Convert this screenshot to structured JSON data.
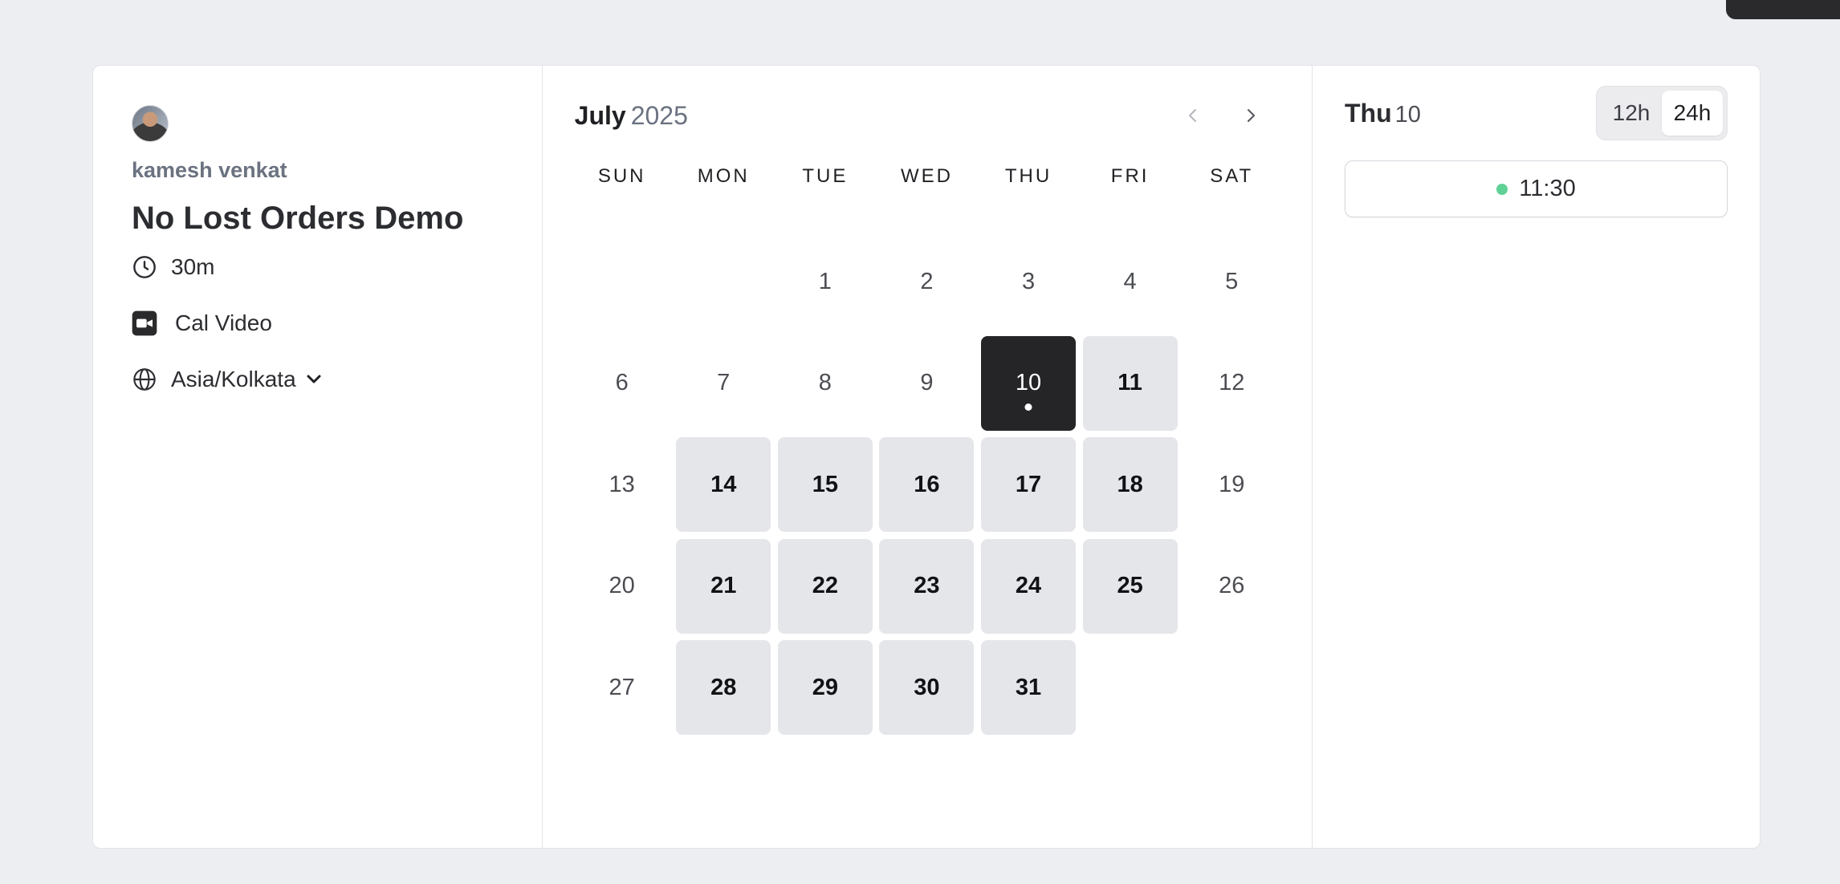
{
  "profile": {
    "host_name": "kamesh venkat",
    "event_title": "No Lost Orders Demo",
    "duration": "30m",
    "location": "Cal Video",
    "timezone": "Asia/Kolkata"
  },
  "calendar": {
    "month": "July",
    "year": "2025",
    "weekdays": [
      "SUN",
      "MON",
      "TUE",
      "WED",
      "THU",
      "FRI",
      "SAT"
    ],
    "days": [
      {
        "label": "",
        "state": "empty"
      },
      {
        "label": "",
        "state": "empty"
      },
      {
        "label": "1",
        "state": "unavailable"
      },
      {
        "label": "2",
        "state": "unavailable"
      },
      {
        "label": "3",
        "state": "unavailable"
      },
      {
        "label": "4",
        "state": "unavailable"
      },
      {
        "label": "5",
        "state": "unavailable"
      },
      {
        "label": "6",
        "state": "unavailable"
      },
      {
        "label": "7",
        "state": "unavailable"
      },
      {
        "label": "8",
        "state": "unavailable"
      },
      {
        "label": "9",
        "state": "unavailable"
      },
      {
        "label": "10",
        "state": "selected"
      },
      {
        "label": "11",
        "state": "available"
      },
      {
        "label": "12",
        "state": "unavailable"
      },
      {
        "label": "13",
        "state": "unavailable"
      },
      {
        "label": "14",
        "state": "available"
      },
      {
        "label": "15",
        "state": "available"
      },
      {
        "label": "16",
        "state": "available"
      },
      {
        "label": "17",
        "state": "available"
      },
      {
        "label": "18",
        "state": "available"
      },
      {
        "label": "19",
        "state": "unavailable"
      },
      {
        "label": "20",
        "state": "unavailable"
      },
      {
        "label": "21",
        "state": "available"
      },
      {
        "label": "22",
        "state": "available"
      },
      {
        "label": "23",
        "state": "available"
      },
      {
        "label": "24",
        "state": "available"
      },
      {
        "label": "25",
        "state": "available"
      },
      {
        "label": "26",
        "state": "unavailable"
      },
      {
        "label": "27",
        "state": "unavailable"
      },
      {
        "label": "28",
        "state": "available"
      },
      {
        "label": "29",
        "state": "available"
      },
      {
        "label": "30",
        "state": "available"
      },
      {
        "label": "31",
        "state": "available"
      }
    ]
  },
  "slots": {
    "day_name": "Thu",
    "day_number": "10",
    "format_options": [
      "12h",
      "24h"
    ],
    "active_format": "24h",
    "times": [
      "11:30"
    ]
  },
  "icons": {
    "duration": "clock-icon",
    "location": "video-camera-icon",
    "timezone": "globe-icon",
    "timezone_toggle": "chevron-down-icon",
    "prev": "chevron-left-icon",
    "next": "chevron-right-icon"
  },
  "colors": {
    "selected_day": "#252527",
    "available_day": "#e5e6ea",
    "slot_indicator": "#5fd196"
  }
}
